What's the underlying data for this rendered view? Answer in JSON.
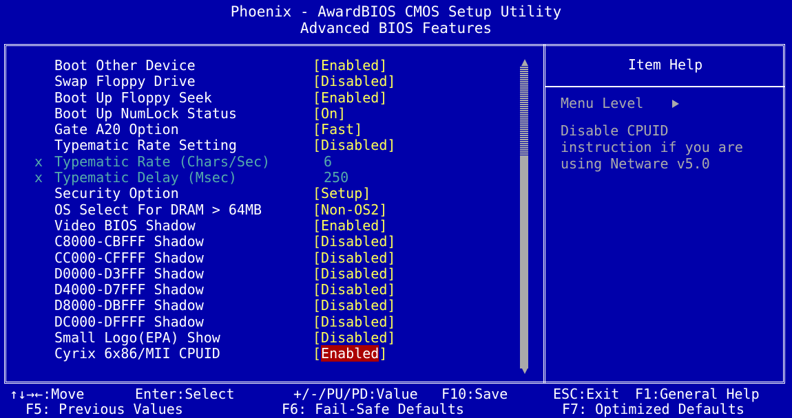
{
  "title": {
    "line1": "Phoenix - AwardBIOS CMOS Setup Utility",
    "line2": "Advanced BIOS Features"
  },
  "items": [
    {
      "label": "Boot Other Device",
      "value": "[Enabled]",
      "disabled": false,
      "selected": false
    },
    {
      "label": "Swap Floppy Drive",
      "value": "[Disabled]",
      "disabled": false,
      "selected": false
    },
    {
      "label": "Boot Up Floppy Seek",
      "value": "[Enabled]",
      "disabled": false,
      "selected": false
    },
    {
      "label": "Boot Up NumLock Status",
      "value": "[On]",
      "disabled": false,
      "selected": false
    },
    {
      "label": "Gate A20 Option",
      "value": "[Fast]",
      "disabled": false,
      "selected": false
    },
    {
      "label": "Typematic Rate Setting",
      "value": "[Disabled]",
      "disabled": false,
      "selected": false
    },
    {
      "label": "Typematic Rate (Chars/Sec)",
      "value": "6",
      "disabled": true,
      "selected": false
    },
    {
      "label": "Typematic Delay (Msec)",
      "value": "250",
      "disabled": true,
      "selected": false
    },
    {
      "label": "Security Option",
      "value": "[Setup]",
      "disabled": false,
      "selected": false
    },
    {
      "label": "OS Select For DRAM > 64MB",
      "value": "[Non-OS2]",
      "disabled": false,
      "selected": false
    },
    {
      "label": "Video BIOS Shadow",
      "value": "[Enabled]",
      "disabled": false,
      "selected": false
    },
    {
      "label": "C8000-CBFFF Shadow",
      "value": "[Disabled]",
      "disabled": false,
      "selected": false
    },
    {
      "label": "CC000-CFFFF Shadow",
      "value": "[Disabled]",
      "disabled": false,
      "selected": false
    },
    {
      "label": "D0000-D3FFF Shadow",
      "value": "[Disabled]",
      "disabled": false,
      "selected": false
    },
    {
      "label": "D4000-D7FFF Shadow",
      "value": "[Disabled]",
      "disabled": false,
      "selected": false
    },
    {
      "label": "D8000-DBFFF Shadow",
      "value": "[Disabled]",
      "disabled": false,
      "selected": false
    },
    {
      "label": "DC000-DFFFF Shadow",
      "value": "[Disabled]",
      "disabled": false,
      "selected": false
    },
    {
      "label": "Small Logo(EPA) Show",
      "value": "[Disabled]",
      "disabled": false,
      "selected": false
    },
    {
      "label": "Cyrix 6x86/MII CPUID",
      "value": "[Enabled]",
      "disabled": false,
      "selected": true
    }
  ],
  "disabled_marker": "x",
  "help": {
    "title": "Item Help",
    "menu_level": "Menu Level",
    "description": "Disable CPUID\ninstruction if you are\nusing Netware v5.0"
  },
  "footer": {
    "move": "↑↓→←:Move",
    "enter": "Enter:Select",
    "value": "+/-/PU/PD:Value",
    "save": "F10:Save",
    "exit": "ESC:Exit",
    "general_help": "F1:General Help",
    "previous": "F5: Previous Values",
    "failsafe": "F6: Fail-Safe Defaults",
    "optimized": "F7: Optimized Defaults"
  },
  "colors": {
    "background": "#0000aa",
    "value": "#ffff55",
    "disabled": "#55aaaa",
    "highlight": "#aa0000"
  }
}
